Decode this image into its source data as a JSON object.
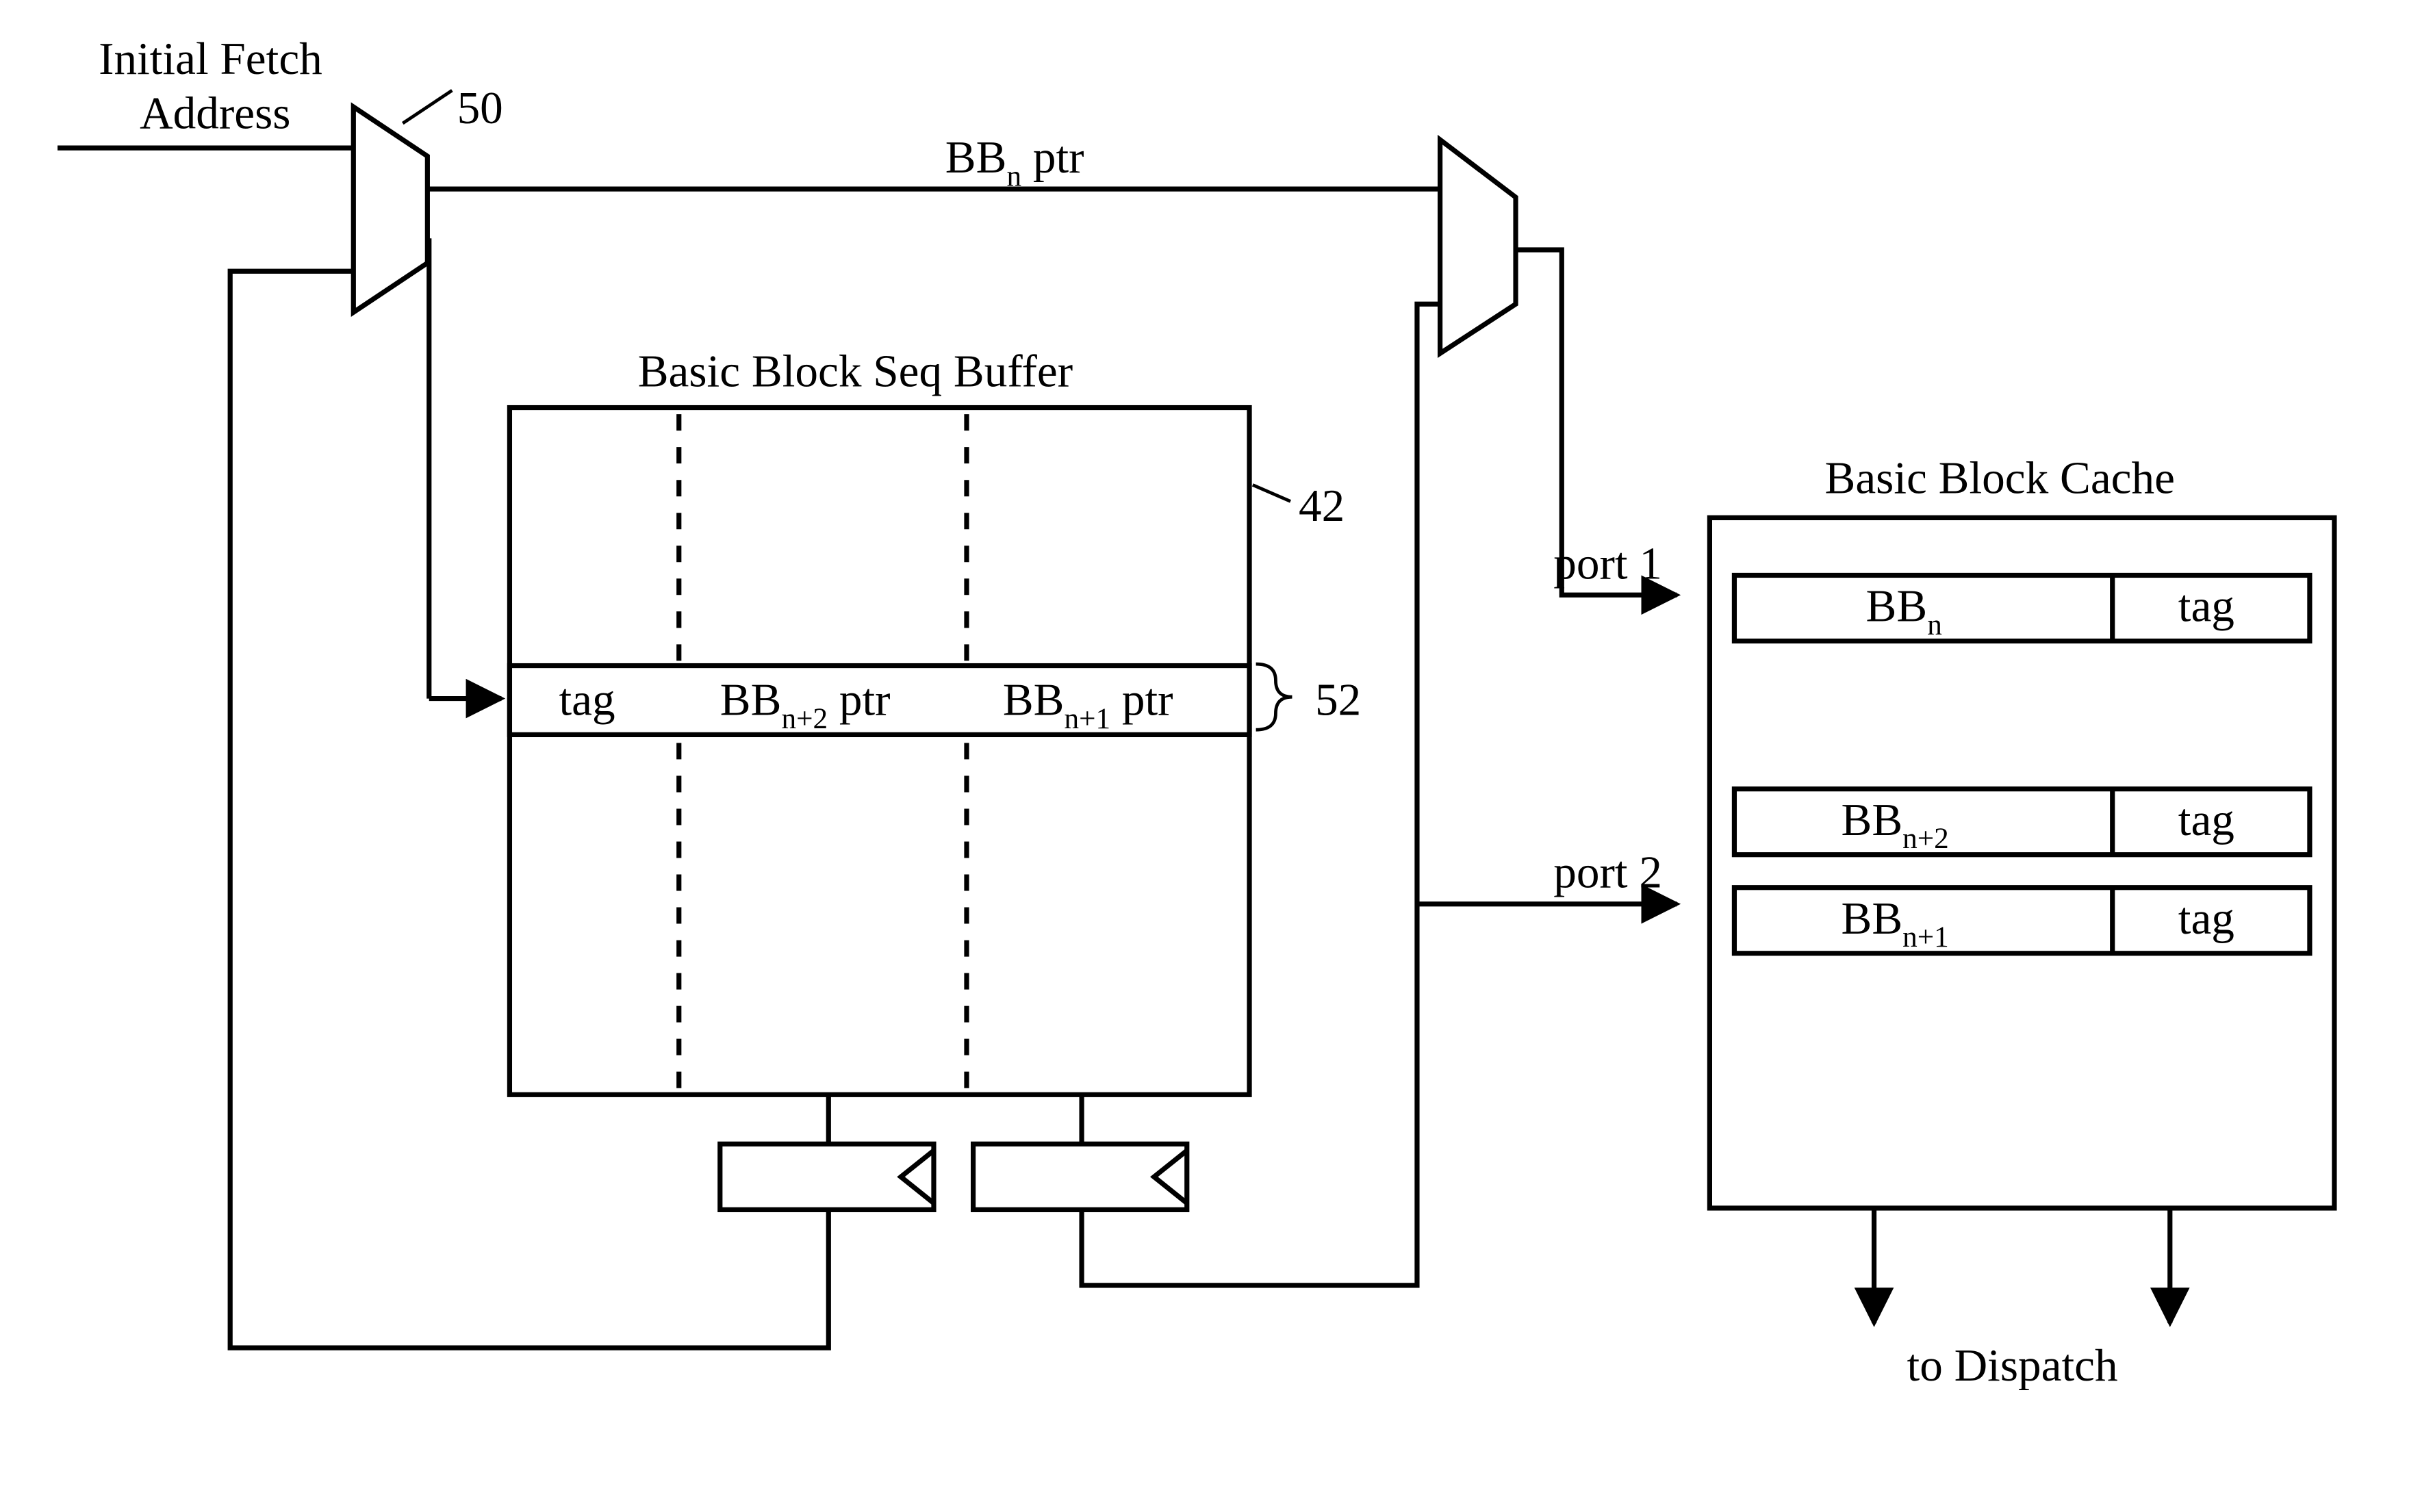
{
  "labels": {
    "initial_fetch_1": "Initial Fetch",
    "initial_fetch_2": "Address",
    "mux1_ref": "50",
    "bbn_ptr_prefix": "BB",
    "bbn_ptr_sub": "n",
    "bbn_ptr_suffix": " ptr",
    "bbsb_title": "Basic Block Seq Buffer",
    "bbsb_ref": "42",
    "row_ref": "52",
    "col_tag": "tag",
    "col_bbn2_prefix": "BB",
    "col_bbn2_sub": "n+2",
    "col_bbn2_suffix": " ptr",
    "col_bbn1_prefix": "BB",
    "col_bbn1_sub": "n+1",
    "col_bbn1_suffix": " ptr",
    "port1": "port 1",
    "port2": "port 2",
    "cache_title": "Basic Block Cache",
    "cache_r1_bb_prefix": "BB",
    "cache_r1_bb_sub": "n",
    "cache_r1_tag": "tag",
    "cache_r2_bb_prefix": "BB",
    "cache_r2_bb_sub": "n+2",
    "cache_r2_tag": "tag",
    "cache_r3_bb_prefix": "BB",
    "cache_r3_bb_sub": "n+1",
    "cache_r3_tag": "tag",
    "to_dispatch": "to Dispatch"
  }
}
